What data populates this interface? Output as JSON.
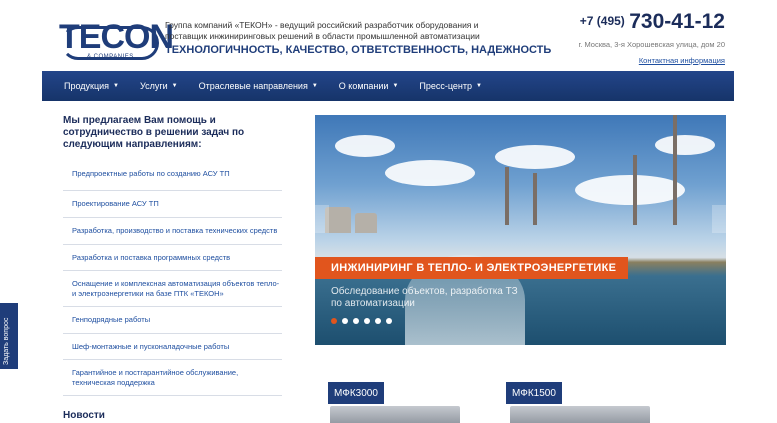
{
  "header": {
    "logo_text": "TECON",
    "logo_sub": "& COMPANIES",
    "tagline": "Группа компаний «ТЕКОН» - ведущий российский разработчик оборудования и поставщик инжиниринговых решений в области промышленной автоматизации",
    "motto": "ТЕХНОЛОГИЧНОСТЬ, КАЧЕСТВО, ОТВЕТСТВЕННОСТЬ, НАДЕЖНОСТЬ",
    "phone_code": "+7 (495)",
    "phone_number": "730-41-12",
    "address": "г. Москва, 3-я Хорошевская улица, дом 20",
    "contacts_link": "Контактная информация"
  },
  "nav": {
    "items": [
      {
        "label": "Продукция"
      },
      {
        "label": "Услуги"
      },
      {
        "label": "Отраслевые направления"
      },
      {
        "label": "О компании"
      },
      {
        "label": "Пресс-центр"
      }
    ]
  },
  "left": {
    "intro": "Мы предлагаем Вам помощь и сотрудничество в решении задач по следующим направлениям:",
    "services": [
      "Предпроектные работы по созданию АСУ ТП",
      "Проектирование АСУ ТП",
      "Разработка, производство и поставка технических средств",
      "Разработка и поставка программных средств",
      "Оснащение и комплексная автоматизация объектов тепло- и электроэнергетики на базе ПТК «ТЕКОН»",
      "Генподрядные работы",
      "Шеф-монтажные и пусконаладочные работы",
      "Гарантийное и постгарантийное обслуживание, техническая поддержка"
    ],
    "news_title": "Новости"
  },
  "slider": {
    "title": "ИНЖИНИРИНГ В ТЕПЛО- И ЭЛЕКТРОЭНЕРГЕТИКЕ",
    "subtitle": "Обследование объектов, разработка ТЗ по автоматизации",
    "dot_count": 6,
    "active_dot": 0
  },
  "products": [
    {
      "label": "МФК3000"
    },
    {
      "label": "МФК1500"
    }
  ],
  "side_tab": {
    "label": "Задать вопрос"
  }
}
